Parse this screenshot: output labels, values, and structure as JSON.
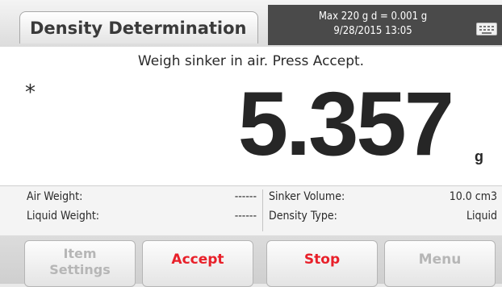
{
  "header": {
    "title": "Density Determination",
    "capacity_line": "Max 220 g   d = 0.001 g",
    "datetime": "9/28/2015  13:05",
    "keyboard_icon": "keyboard-icon"
  },
  "display": {
    "instruction": "Weigh sinker in air. Press Accept.",
    "stable_indicator": "*",
    "reading": "5.357",
    "unit": "g"
  },
  "params": {
    "air_weight_label": "Air Weight:",
    "air_weight_value": "------",
    "liquid_weight_label": "Liquid Weight:",
    "liquid_weight_value": "------",
    "sinker_volume_label": "Sinker Volume:",
    "sinker_volume_value": "10.0 cm3",
    "density_type_label": "Density Type:",
    "density_type_value": "Liquid"
  },
  "buttons": {
    "item_settings_line1": "Item",
    "item_settings_line2": "Settings",
    "accept": "Accept",
    "stop": "Stop",
    "menu": "Menu"
  },
  "colors": {
    "action_red": "#e8202a",
    "disabled_gray": "#b6b6b6",
    "info_bg": "#4a4a4a"
  }
}
